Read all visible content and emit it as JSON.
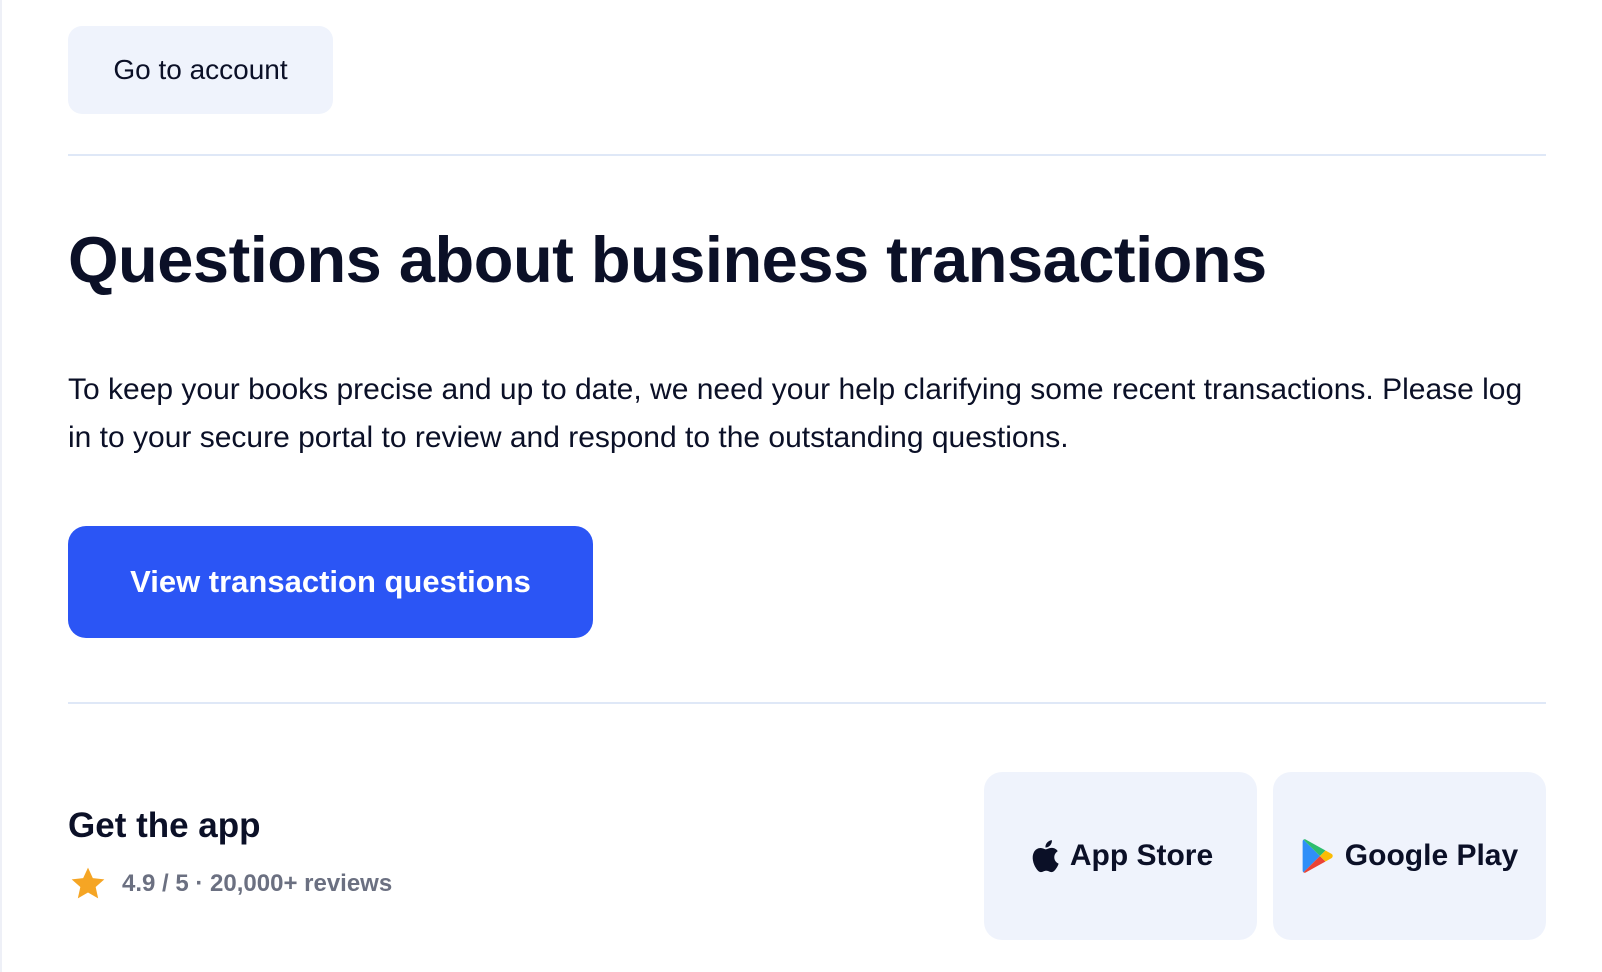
{
  "header": {
    "account_button": "Go to account"
  },
  "main": {
    "title": "Questions about business transactions",
    "body": "To keep your books precise and up to date, we need your help clarifying some recent transactions. Please log in to your secure portal to review and respond to the outstanding questions.",
    "cta_label": "View transaction questions"
  },
  "app": {
    "title": "Get the app",
    "rating_text": "4.9 / 5 · 20,000+ reviews",
    "rating_icon": "star-icon",
    "app_store_label": "App Store",
    "app_store_icon": "apple-icon",
    "google_play_label": "Google Play",
    "google_play_icon": "google-play-icon"
  },
  "colors": {
    "accent": "#2b55f5",
    "button_bg": "#eff3fc",
    "text": "#0b1027",
    "muted": "#6b7081",
    "star": "#f5a524",
    "divider": "#dfe8f7"
  }
}
